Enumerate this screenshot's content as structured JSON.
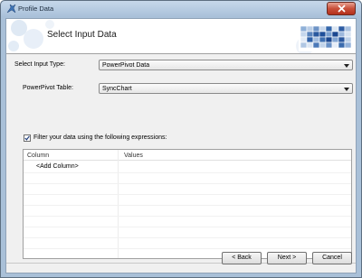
{
  "window": {
    "title": "Profile Data"
  },
  "header": {
    "title": "Select Input Data"
  },
  "form": {
    "input_type_label": "Select Input Type:",
    "input_type_value": "PowerPivot Data",
    "table_label": "PowerPivot Table:",
    "table_value": "SyncChart",
    "filter_label": "Filter your data  using the following expressions:",
    "filter_checked": true
  },
  "grid": {
    "columns": [
      "Column",
      "Values"
    ],
    "rows": [
      [
        "<Add Column>",
        ""
      ]
    ]
  },
  "buttons": {
    "back": "< Back",
    "next": "Next >",
    "cancel": "Cancel"
  },
  "icons": {
    "app": "app-icon",
    "close": "close-icon",
    "logo": "logo-graphic",
    "check": "check-icon"
  },
  "colors": {
    "close_button": "#c9503a",
    "logo_blue": "#1f4f9a",
    "title_bar": "#a8c0d9"
  }
}
